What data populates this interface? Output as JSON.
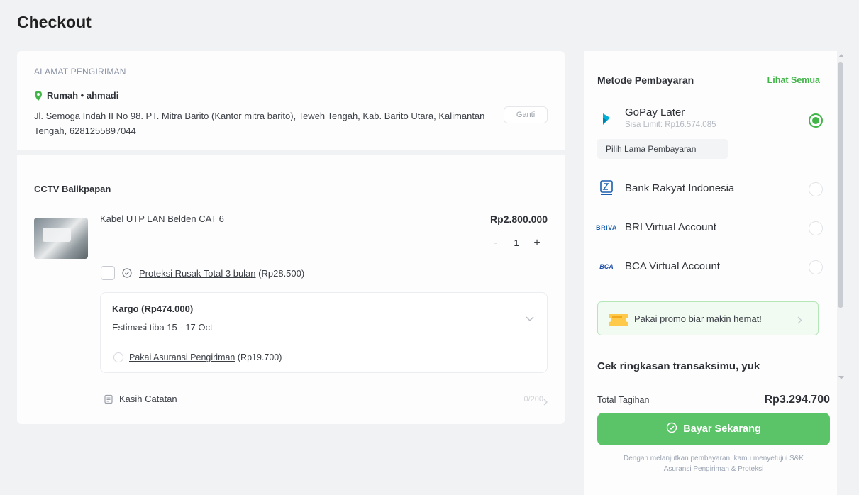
{
  "page": {
    "title": "Checkout"
  },
  "address": {
    "section_label": "ALAMAT PENGIRIMAN",
    "name": "Rumah • ahmadi",
    "text": "Jl. Semoga Indah II No 98. PT. Mitra Barito (Kantor mitra barito), Teweh Tengah, Kab. Barito Utara, Kalimantan Tengah, 6281255897044",
    "change_button": "Ganti"
  },
  "shop": {
    "name": "CCTV Balikpapan",
    "product": {
      "name": "Kabel UTP LAN Belden CAT 6",
      "price": "Rp2.800.000",
      "quantity": "1",
      "minus": "-",
      "plus": "+"
    },
    "protection": {
      "label": "Proteksi Rusak Total 3 bulan",
      "price": "(Rp28.500)"
    },
    "shipping": {
      "title": "Kargo (Rp474.000)",
      "eta": "Estimasi tiba 15 - 17 Oct",
      "insurance_label": "Pakai Asuransi Pengiriman",
      "insurance_price": "(Rp19.700)"
    },
    "note": {
      "label": "Kasih Catatan",
      "count": "0/200"
    }
  },
  "payment": {
    "header": "Metode Pembayaran",
    "see_all": "Lihat Semua",
    "methods": [
      {
        "name": "GoPay Later",
        "sub": "Sisa Limit: Rp16.574.085",
        "selected": true
      },
      {
        "name": "Bank Rakyat Indonesia",
        "sub": "",
        "selected": false
      },
      {
        "name": "BRI Virtual Account",
        "sub": "",
        "selected": false
      },
      {
        "name": "BCA Virtual Account",
        "sub": "",
        "selected": false
      }
    ],
    "tenor_label": "Pilih Lama Pembayaran",
    "logo_text": {
      "briva": "BRIVA",
      "bca": "BCA"
    },
    "accent_color": "#42b549"
  },
  "promo": {
    "text": "Pakai promo biar makin hemat!"
  },
  "summary": {
    "title": "Cek ringkasan transaksimu, yuk",
    "total_label": "Total Tagihan",
    "total_value": "Rp3.294.700",
    "pay_button": "Bayar Sekarang",
    "terms_text": "Dengan melanjutkan pembayaran, kamu menyetujui S&K",
    "terms_link": "Asuransi Pengiriman & Proteksi"
  },
  "icons": {
    "location": "location-pin-icon",
    "shield": "shield-icon",
    "note": "note-icon",
    "chevron": "chevron-icon",
    "gopay": "gopay-later-icon",
    "bri": "bri-bank-icon",
    "promo": "promo-coupon-icon"
  }
}
